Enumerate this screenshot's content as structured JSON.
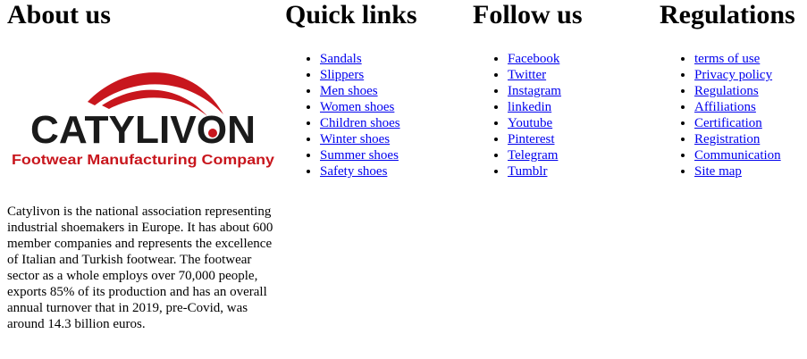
{
  "about": {
    "heading": "About us",
    "logo": {
      "name": "CATYLIVON",
      "tagline": "Footwear Manufacturing Company"
    },
    "text": "Catylivon is the national association representing industrial shoemakers in Europe. It has about 600 member companies and represents the excellence of Italian and Turkish footwear. The footwear sector as a whole employs over 70,000 people, exports 85% of its production and has an overall annual turnover that in 2019, pre-Covid, was around 14.3 billion euros."
  },
  "quick_links": {
    "heading": "Quick links",
    "items": [
      "Sandals",
      "Slippers",
      "Men shoes",
      "Women shoes",
      "Children shoes",
      "Winter shoes",
      "Summer shoes",
      "Safety shoes"
    ]
  },
  "follow_us": {
    "heading": "Follow us",
    "items": [
      "Facebook",
      "Twitter",
      "Instagram",
      "linkedin",
      "Youtube",
      "Pinterest",
      "Telegram",
      "Tumblr"
    ]
  },
  "regulations": {
    "heading": "Regulations",
    "items": [
      "terms of use",
      "Privacy policy",
      "Regulations",
      "Affiliations",
      "Certification",
      "Registration",
      "Communication",
      "Site map"
    ]
  },
  "colors": {
    "link": "#0000ee",
    "logo_red": "#c8161d",
    "logo_black": "#1a1a1a"
  }
}
